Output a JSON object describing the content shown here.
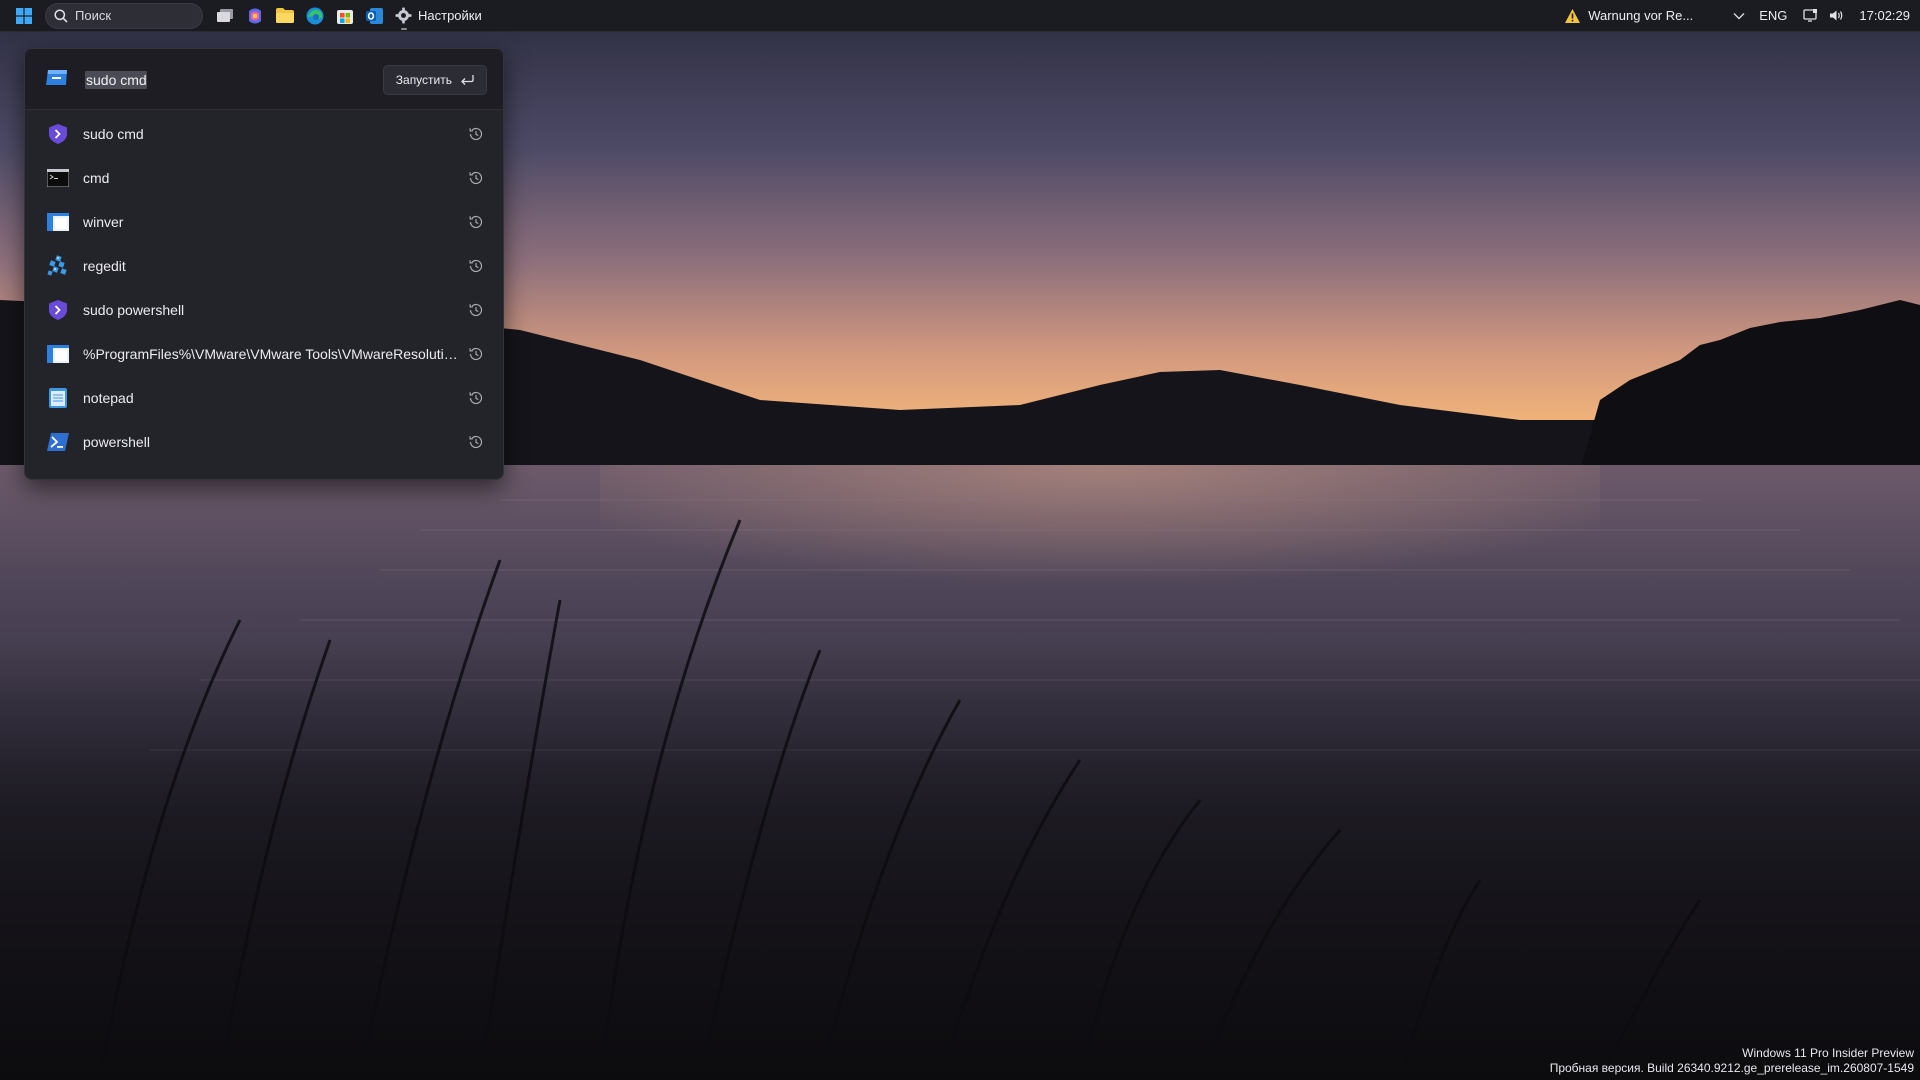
{
  "taskbar": {
    "search_placeholder": "Поиск",
    "settings_label": "Настройки",
    "warning_text": "Warnung vor Re...",
    "language": "ENG",
    "clock": "17:02:29"
  },
  "run": {
    "input_value": "sudo cmd",
    "run_button_label": "Запустить",
    "items": [
      {
        "label": "sudo cmd",
        "icon": "sudo-shield-icon"
      },
      {
        "label": "cmd",
        "icon": "cmd-console-icon"
      },
      {
        "label": "winver",
        "icon": "window-icon"
      },
      {
        "label": "regedit",
        "icon": "registry-editor-icon"
      },
      {
        "label": "sudo powershell",
        "icon": "sudo-shield-icon"
      },
      {
        "label": "%ProgramFiles%\\VMware\\VMware Tools\\VMwareResolutio...",
        "icon": "window-icon"
      },
      {
        "label": "notepad",
        "icon": "notepad-icon"
      },
      {
        "label": "powershell",
        "icon": "powershell-icon"
      }
    ]
  },
  "watermark": {
    "line1": "Windows 11 Pro Insider Preview",
    "line2": "Пробная версия. Build 26340.9212.ge_prerelease_im.260807-1549"
  },
  "colors": {
    "taskbar": "#1b1c22",
    "panel": "#23232a",
    "accent": "#2d7fe0",
    "sudo_purple": "#6a4ad8"
  }
}
